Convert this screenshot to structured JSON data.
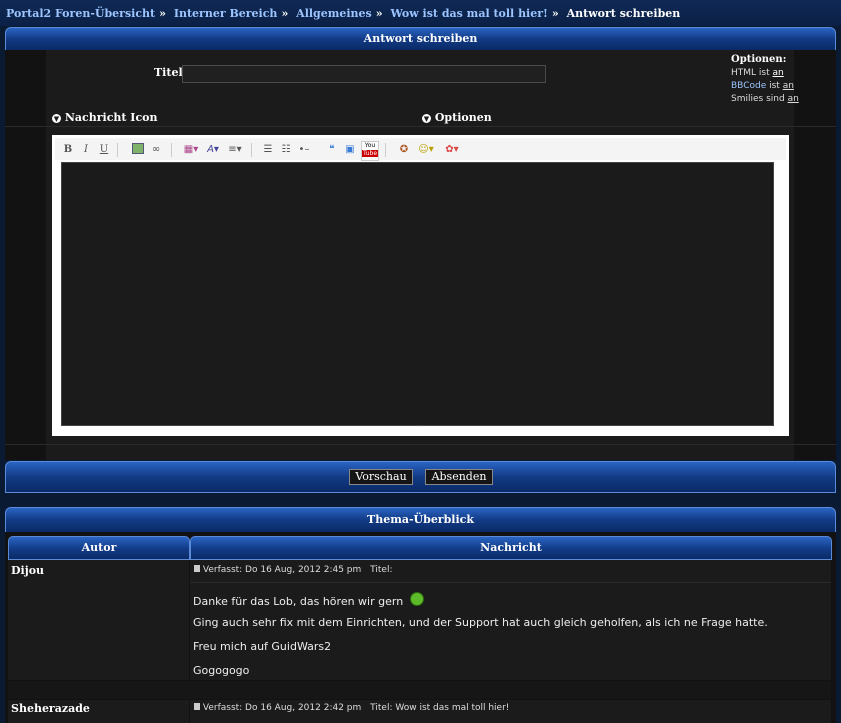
{
  "breadcrumb": {
    "items": [
      "Portal2 Foren-Übersicht",
      "Interner Bereich",
      "Allgemeines",
      "Wow ist das mal toll hier!"
    ],
    "current": "Antwort schreiben"
  },
  "reply_form": {
    "header": "Antwort schreiben",
    "title_label": "Titel:",
    "title_value": "",
    "options": {
      "heading": "Optionen:",
      "html_prefix": "HTML ist",
      "html_state": "an",
      "bbcode_label": "BBCode",
      "bbcode_mid": "ist",
      "bbcode_state": "an",
      "smilies_prefix": "Smilies sind",
      "smilies_state": "an"
    },
    "nachricht_icon_label": "Nachricht Icon",
    "optionen_label": "Optionen",
    "toolbar": {
      "bold": "B",
      "italic": "I",
      "underline": "U",
      "youtube_top": "You",
      "youtube_bottom": "Tube"
    },
    "message_value": "",
    "preview_button": "Vorschau",
    "submit_button": "Absenden"
  },
  "thread_overview": {
    "header": "Thema-Überblick",
    "col_author": "Autor",
    "col_message": "Nachricht",
    "posts": [
      {
        "author": "Dijou",
        "meta": "Verfasst: Do 16 Aug, 2012 2:45 pm",
        "title_label": "Titel:",
        "title": "",
        "lines": [
          "Danke für das Lob, das hören wir gern",
          "Ging auch sehr fix mit dem Einrichten, und der Support hat auch gleich geholfen, als ich ne Frage hatte.",
          "Freu mich auf GuidWars2",
          "Gogogogo"
        ]
      },
      {
        "author": "Sheherazade",
        "meta": "Verfasst: Do 16 Aug, 2012 2:42 pm",
        "title_label": "Titel:",
        "title": "Wow ist das mal toll hier!"
      }
    ]
  },
  "colors": {
    "accent": "#123b85",
    "panel": "#1b1b1b",
    "link": "#9cc4ff"
  }
}
